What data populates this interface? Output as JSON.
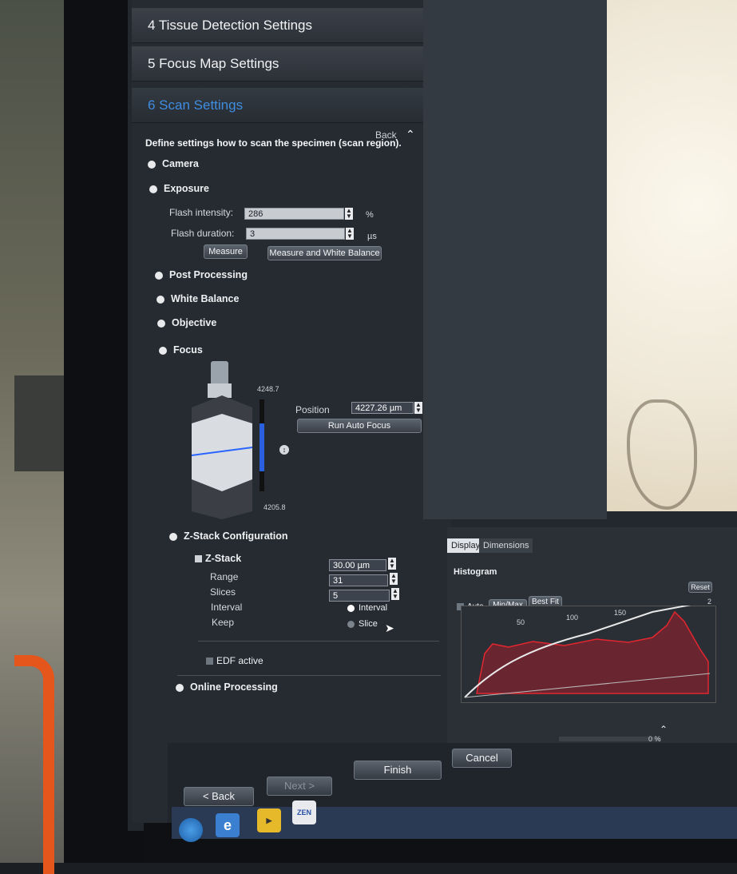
{
  "workflow": {
    "steps": [
      {
        "label": "4  Tissue Detection Settings"
      },
      {
        "label": "5  Focus Map Settings"
      },
      {
        "label": "6  Scan Settings"
      }
    ]
  },
  "scan_settings": {
    "back_label": "Back",
    "description": "Define settings how to scan the specimen (scan region).",
    "sections": {
      "camera": "Camera",
      "exposure": "Exposure",
      "post_processing": "Post Processing",
      "white_balance": "White Balance",
      "objective": "Objective",
      "focus": "Focus",
      "zstack_config": "Z-Stack Configuration",
      "online_processing": "Online Processing"
    },
    "exposure": {
      "flash_intensity_label": "Flash intensity:",
      "flash_intensity_value": "286",
      "flash_intensity_unit": "%",
      "flash_duration_label": "Flash duration:",
      "flash_duration_value": "3",
      "flash_duration_unit": "µs",
      "measure_label": "Measure",
      "measure_wb_label": "Measure and White Balance"
    },
    "focus": {
      "scale_top": "4248.7",
      "scale_bottom": "4205.8",
      "position_label": "Position",
      "position_value": "4227.26 µm",
      "run_autofocus_label": "Run Auto Focus",
      "focus_level": 0.5
    },
    "zstack": {
      "zstack_label": "Z-Stack",
      "range_label": "Range",
      "range_value": "30.00 µm",
      "slices_label": "Slices",
      "slices_value": "31",
      "interval_label": "Interval",
      "interval_value": "5",
      "keep_label": "Keep",
      "keep_interval": "Interval",
      "keep_slice": "Slice",
      "edf_label": "EDF active"
    }
  },
  "display": {
    "tabs": [
      "Display",
      "Dimensions"
    ],
    "histogram_label": "Histogram",
    "auto_label": "Auto",
    "minmax_label": "Min/Max",
    "bestfit_label": "Best Fit",
    "reset_label": "Reset",
    "ticks": [
      "50",
      "100",
      "150",
      "2"
    ],
    "progress_text": "0 %",
    "progress": 0.0
  },
  "nav": {
    "back": "< Back",
    "next": "Next >",
    "finish": "Finish",
    "cancel": "Cancel"
  },
  "taskbar": {
    "zen_label": "ZEN"
  }
}
